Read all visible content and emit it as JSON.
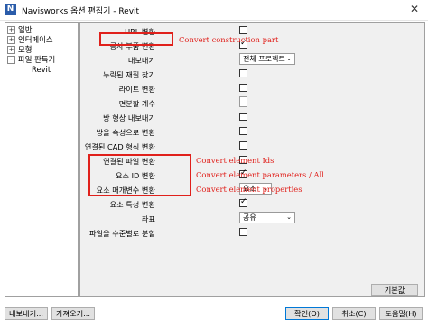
{
  "window": {
    "title": "Navisworks 옵션 편집기 - Revit",
    "icon": "N"
  },
  "tree": {
    "items": [
      {
        "label": "일반",
        "expander": "+"
      },
      {
        "label": "인터페이스",
        "expander": "+"
      },
      {
        "label": "모형",
        "expander": "+"
      },
      {
        "label": "파일 판독기",
        "expander": "-"
      }
    ],
    "child": "Revit"
  },
  "options": {
    "url_convert": "URL 변환",
    "construction_part": "공사 부품 변환",
    "export": "내보내기",
    "export_value": "전체 프로젝트",
    "find_missing_material": "누락된 재질 찾기",
    "light_convert": "라이트 변환",
    "split_count": "면분할 계수",
    "room_geometry": "방 형상 내보내기",
    "room_attribute": "방을 속성으로 변환",
    "linked_cad": "연결된 CAD 형식 변환",
    "linked_file": "연결된 파일 변환",
    "element_id": "요소 ID 변환",
    "element_params": "요소 매개변수 변환",
    "element_params_value": "요소",
    "element_props": "요소 특성 변환",
    "coordinates": "좌표",
    "coordinates_value": "공유",
    "split_by_level": "파일을 수준별로 분할"
  },
  "annotations": {
    "construction_part": "Convert construction part",
    "element_ids": "Convert element Ids",
    "element_params": "Convert element parameters / All",
    "element_props": "Convert element properties"
  },
  "buttons": {
    "defaults": "기본값",
    "export": "내보내기...",
    "import": "가져오기...",
    "ok": "확인(O)",
    "cancel": "취소(C)",
    "help": "도움말(H)"
  },
  "colors": {
    "highlight": "#e0201b",
    "panel_bg": "#f0f0f0"
  }
}
